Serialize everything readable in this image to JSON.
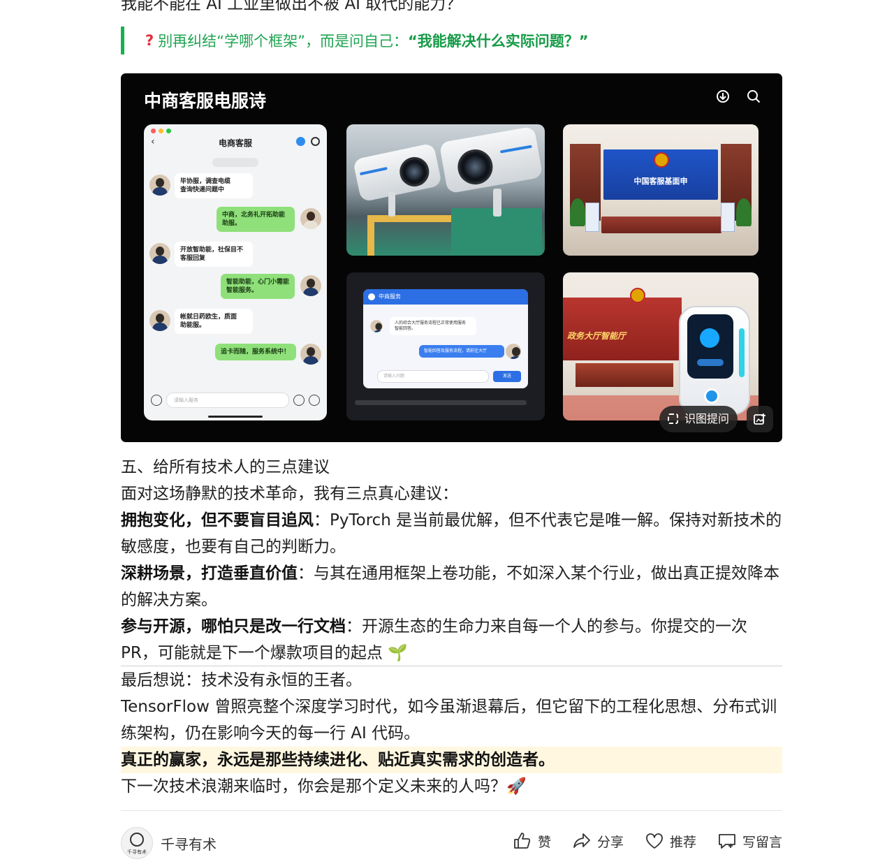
{
  "top_line": "我能不能在 AI 工业里做出不被 AI 取代的能力？",
  "quote": {
    "icon": "question-mark-icon",
    "prefix": "别再纠结“学哪个框架”，而是问自己：",
    "emphasis": "“我能解决什么实际问题？”"
  },
  "banner": {
    "title": "中商客服电服诗",
    "icons": [
      "download-icon",
      "search-icon"
    ],
    "phone": {
      "header": "电商客服",
      "messages": [
        {
          "side": "in",
          "text": "毕协服，调查电缆\n查询快递问题中"
        },
        {
          "side": "out",
          "text": "中商，北务礼开拓助能\n助服。"
        },
        {
          "side": "in",
          "text": "开放智助能，社保目不\n客服回复"
        },
        {
          "side": "out",
          "text": "智能助能，心门小需能\n智能服务。"
        },
        {
          "side": "in",
          "text": "帐就日药欧生，质面\n助能服。"
        },
        {
          "side": "out",
          "text": "追卡而随，服务系统中！"
        }
      ],
      "input_placeholder": "请输入服务"
    },
    "chat_widget": {
      "title": "中商服务",
      "in_text": "人的综合大厅服务流程已正常使用服务\n智能回答。",
      "out_text": "智能回答及服务流程，请前往大厅",
      "placeholder": "请输入问题",
      "send": "发送"
    },
    "hall1_sign": "中国客服基面申",
    "hall2_sign": "政务大厅智能厅",
    "ocr_button": "识图提问",
    "edit_icon": "image-edit-icon"
  },
  "section_title": "五、给所有技术人的三点建议",
  "intro": "面对这场静默的技术革命，我有三点真心建议：",
  "tips": [
    {
      "bold": "拥抱变化，但不要盲目追风",
      "text": "：PyTorch 是当前最优解，但不代表它是唯一解。保持对新技术的敏感度，也要有自己的判断力。"
    },
    {
      "bold": "深耕场景，打造垂直价值",
      "text": "：与其在通用框架上卷功能，不如深入某个行业，做出真正提效降本的解决方案。"
    },
    {
      "bold": "参与开源，哪怕只是改一行文档",
      "text": "：开源生态的生命力来自每一个人的参与。你提交的一次 PR，可能就是下一个爆款项目的起点 🌱"
    }
  ],
  "closing": [
    "最后想说：技术没有永恒的王者。",
    "TensorFlow 曾照亮整个深度学习时代，如今虽渐退幕后，但它留下的工程化思想、分布式训练架构，仍在影响今天的每一行 AI 代码。"
  ],
  "highlight": "真正的赢家，永远是那些持续进化、贴近真实需求的创造者。",
  "final_question": "下一次技术浪潮来临时，你会是那个定义未来的人吗？🚀",
  "footer": {
    "logo_text": "千寻有术",
    "author": "千寻有术",
    "actions": [
      {
        "icon": "thumbs-up-icon",
        "label": "赞"
      },
      {
        "icon": "share-icon",
        "label": "分享"
      },
      {
        "icon": "heart-icon",
        "label": "推荐"
      },
      {
        "icon": "comment-icon",
        "label": "写留言"
      }
    ]
  },
  "colors": {
    "quote_green": "#1fa451",
    "quote_bar": "#17b04f",
    "highlight_bg": "#fff7e0",
    "banner_bg": "#050505"
  }
}
